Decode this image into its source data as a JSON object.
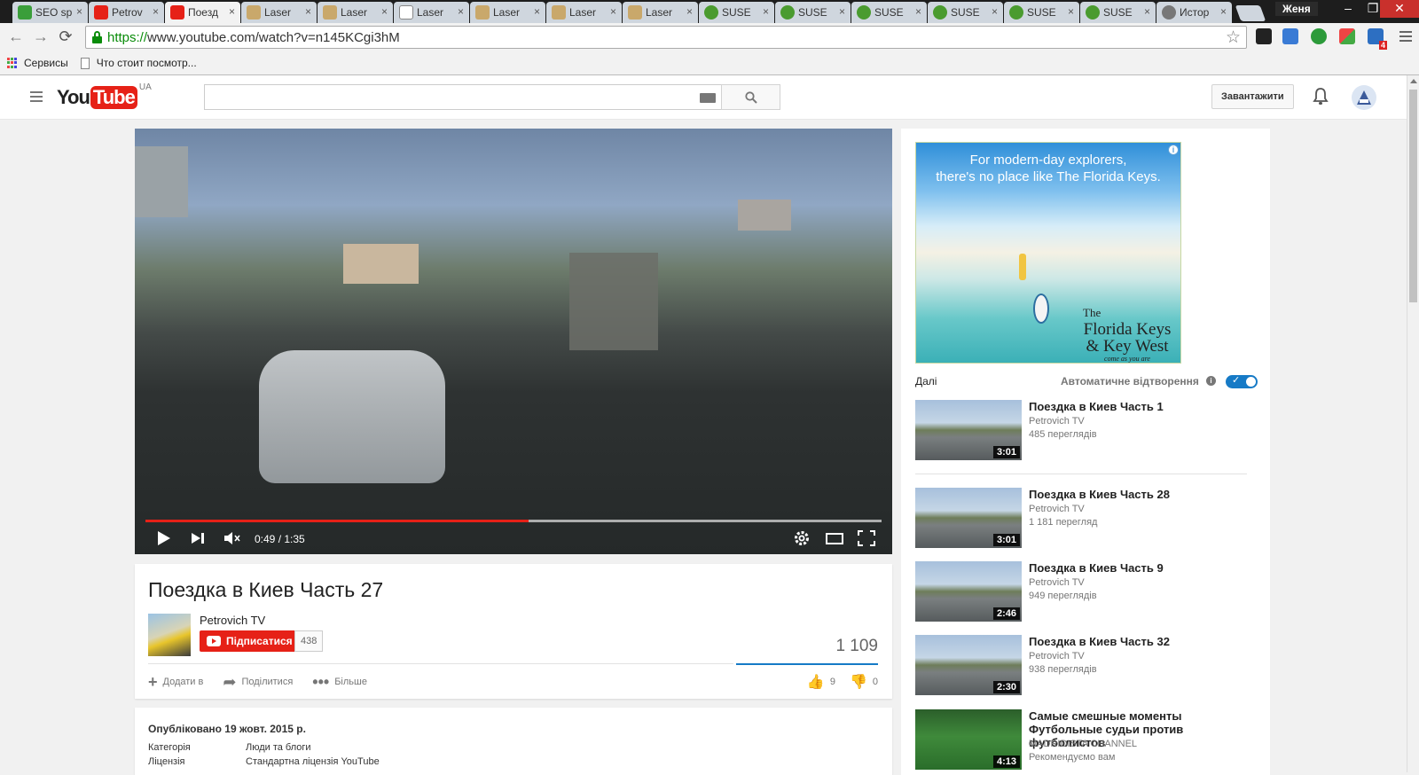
{
  "browser": {
    "tabs": [
      {
        "label": "SEO sp",
        "favicon": "seo-icon",
        "active": false
      },
      {
        "label": "Petrov",
        "favicon": "youtube-icon",
        "active": false
      },
      {
        "label": "Поезд",
        "favicon": "youtube-icon",
        "active": true
      },
      {
        "label": "Laser",
        "favicon": "laser-icon",
        "active": false
      },
      {
        "label": "Laser",
        "favicon": "laser-icon",
        "active": false
      },
      {
        "label": "Laser",
        "favicon": "document-icon",
        "active": false
      },
      {
        "label": "Laser",
        "favicon": "laser-icon",
        "active": false
      },
      {
        "label": "Laser",
        "favicon": "laser-icon",
        "active": false
      },
      {
        "label": "Laser",
        "favicon": "laser-icon",
        "active": false
      },
      {
        "label": "SUSE",
        "favicon": "suse-icon",
        "active": false
      },
      {
        "label": "SUSE",
        "favicon": "suse-icon",
        "active": false
      },
      {
        "label": "SUSE",
        "favicon": "suse-icon",
        "active": false
      },
      {
        "label": "SUSE",
        "favicon": "suse-icon",
        "active": false
      },
      {
        "label": "SUSE",
        "favicon": "suse-icon",
        "active": false
      },
      {
        "label": "SUSE",
        "favicon": "suse-icon",
        "active": false
      },
      {
        "label": "Истор",
        "favicon": "history-icon",
        "active": false
      }
    ],
    "user_name": "Женя",
    "url_scheme": "https://",
    "url_rest": "www.youtube.com/watch?v=n145KCgi3hM",
    "bookmarks": [
      {
        "label": "Сервисы",
        "icon": "apps-icon"
      },
      {
        "label": "Что стоит посмотр...",
        "icon": "page-icon"
      }
    ],
    "extension_badge": "4"
  },
  "youtube": {
    "region": "UA",
    "search_placeholder": "",
    "upload_label": "Завантажити"
  },
  "player": {
    "current_time": "0:49",
    "duration": "1:35",
    "time_display": "0:49 / 1:35",
    "played_fraction": 0.52,
    "loaded_fraction": 1.0
  },
  "video": {
    "title": "Поездка в Киев Часть 27",
    "channel": "Petrovich TV",
    "subscribe_label": "Підписатися",
    "subscriber_count": "438",
    "view_count": "1 109",
    "actions": {
      "add_to": "Додати в",
      "share": "Поділитися",
      "more": "Більше"
    },
    "likes": "9",
    "dislikes": "0",
    "published": "Опубліковано 19 жовт. 2015 р.",
    "category_label": "Категорія",
    "category_value": "Люди та блоги",
    "license_label": "Ліцензія",
    "license_value": "Стандартна ліцензія YouTube"
  },
  "ad": {
    "headline_1": "For modern-day explorers,",
    "headline_2": "there's no place like The Florida Keys.",
    "logo_line_1": "The",
    "logo_line_2": "Florida Keys",
    "logo_line_3": "& Key West",
    "logo_tagline": "come as you are"
  },
  "sidebar": {
    "up_next_label": "Далі",
    "autoplay_label": "Автоматичне відтворення",
    "autoplay_on": true,
    "up_next": {
      "title": "Поездка в Киев Часть 1",
      "channel": "Petrovich TV",
      "views": "485 переглядів",
      "duration": "3:01"
    },
    "related": [
      {
        "title": "Поездка в Киев Часть 28",
        "channel": "Petrovich TV",
        "views": "1 181 перегляд",
        "duration": "3:01"
      },
      {
        "title": "Поездка в Киев Часть 9",
        "channel": "Petrovich TV",
        "views": "949 переглядів",
        "duration": "2:46"
      },
      {
        "title": "Поездка в Киев Часть 32",
        "channel": "Petrovich TV",
        "views": "938 переглядів",
        "duration": "2:30"
      },
      {
        "title": "Самые смешные моменты Футбольные судьи против футболистов",
        "channel": "MADRIDISTA CHANNEL",
        "views": "Рекомендуємо вам",
        "duration": "4:13"
      }
    ]
  },
  "colors": {
    "youtube_red": "#e62117",
    "link_blue": "#167ac6",
    "secure_green": "#0a8c0a"
  }
}
